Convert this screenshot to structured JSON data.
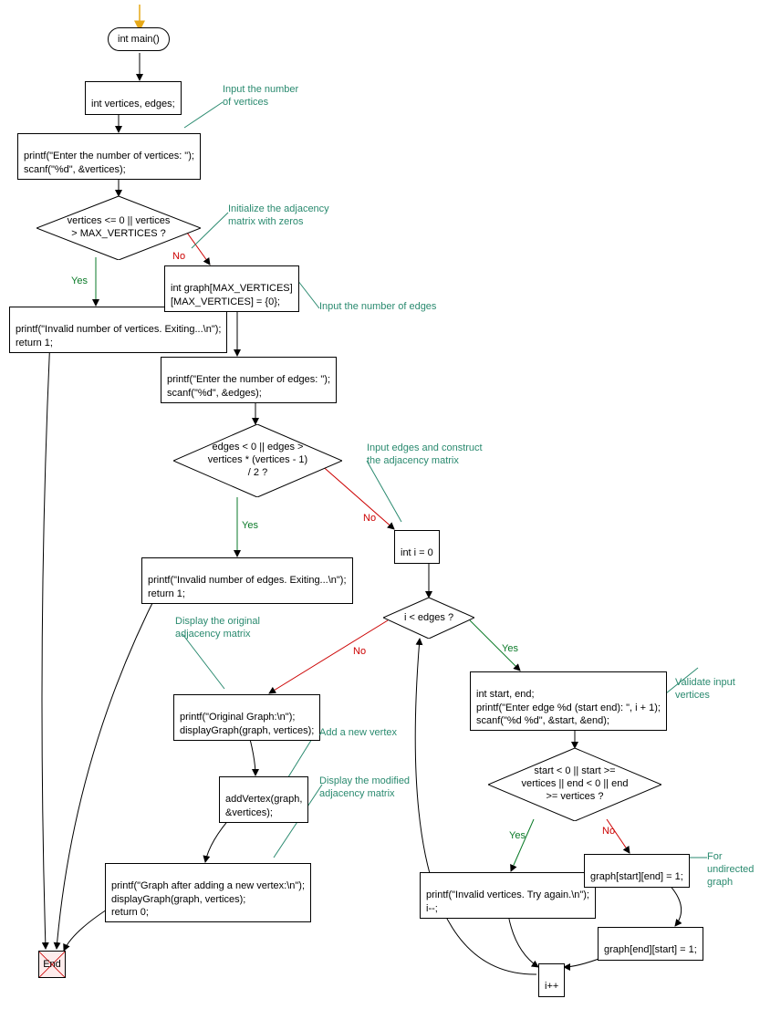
{
  "chart_data": {
    "type": "flowchart",
    "title": "",
    "nodes": {
      "start": {
        "label": "int main()",
        "shape": "terminal"
      },
      "n1": {
        "label": "int vertices, edges;",
        "shape": "process"
      },
      "n2": {
        "label": "printf(\"Enter the number of vertices: \");\nscanf(\"%d\", &vertices);",
        "shape": "process"
      },
      "d1": {
        "label": "vertices <= 0 || vertices\n> MAX_VERTICES ?",
        "shape": "decision"
      },
      "n3": {
        "label": "printf(\"Invalid number of vertices. Exiting...\\n\");\nreturn 1;",
        "shape": "process"
      },
      "n4": {
        "label": "int graph[MAX_VERTICES]\n[MAX_VERTICES] = {0};",
        "shape": "process"
      },
      "n5": {
        "label": "printf(\"Enter the number of edges: \");\nscanf(\"%d\", &edges);",
        "shape": "process"
      },
      "d2": {
        "label": "edges < 0 || edges >\nvertices * (vertices - 1)\n/ 2 ?",
        "shape": "decision"
      },
      "n6": {
        "label": "printf(\"Invalid number of edges. Exiting...\\n\");\nreturn 1;",
        "shape": "process"
      },
      "n7": {
        "label": "int i = 0",
        "shape": "process"
      },
      "d3": {
        "label": "i < edges ?",
        "shape": "decision"
      },
      "n8": {
        "label": "int start, end;\nprintf(\"Enter edge %d (start end): \", i + 1);\nscanf(\"%d %d\", &start, &end);",
        "shape": "process"
      },
      "d4": {
        "label": "start < 0 || start >=\nvertices || end < 0 || end\n>= vertices ?",
        "shape": "decision"
      },
      "n9": {
        "label": "printf(\"Invalid vertices. Try again.\\n\");\ni--;",
        "shape": "process"
      },
      "n10": {
        "label": "graph[start][end] = 1;",
        "shape": "process"
      },
      "n11": {
        "label": "graph[end][start] = 1;",
        "shape": "process"
      },
      "n12": {
        "label": "i++",
        "shape": "process"
      },
      "n13": {
        "label": "printf(\"Original Graph:\\n\");\ndisplayGraph(graph, vertices);",
        "shape": "process"
      },
      "n14": {
        "label": "addVertex(graph,\n&vertices);",
        "shape": "process"
      },
      "n15": {
        "label": "printf(\"Graph after adding a new vertex:\\n\");\ndisplayGraph(graph, vertices);\nreturn 0;",
        "shape": "process"
      },
      "end": {
        "label": "End",
        "shape": "end"
      }
    },
    "edges": [
      {
        "from": "start",
        "to": "n1"
      },
      {
        "from": "n1",
        "to": "n2"
      },
      {
        "from": "n2",
        "to": "d1"
      },
      {
        "from": "d1",
        "to": "n3",
        "label": "Yes"
      },
      {
        "from": "d1",
        "to": "n4",
        "label": "No"
      },
      {
        "from": "n4",
        "to": "n5"
      },
      {
        "from": "n5",
        "to": "d2"
      },
      {
        "from": "d2",
        "to": "n6",
        "label": "Yes"
      },
      {
        "from": "d2",
        "to": "n7",
        "label": "No"
      },
      {
        "from": "n7",
        "to": "d3"
      },
      {
        "from": "d3",
        "to": "n8",
        "label": "Yes"
      },
      {
        "from": "d3",
        "to": "n13",
        "label": "No"
      },
      {
        "from": "n8",
        "to": "d4"
      },
      {
        "from": "d4",
        "to": "n9",
        "label": "Yes"
      },
      {
        "from": "d4",
        "to": "n10",
        "label": "No"
      },
      {
        "from": "n10",
        "to": "n11"
      },
      {
        "from": "n9",
        "to": "n12"
      },
      {
        "from": "n11",
        "to": "n12"
      },
      {
        "from": "n12",
        "to": "d3"
      },
      {
        "from": "n13",
        "to": "n14"
      },
      {
        "from": "n14",
        "to": "n15"
      },
      {
        "from": "n3",
        "to": "end"
      },
      {
        "from": "n6",
        "to": "end"
      },
      {
        "from": "n15",
        "to": "end"
      }
    ],
    "annotations": {
      "a1": "Input the number\nof vertices",
      "a2": "Initialize the adjacency\nmatrix with zeros",
      "a3": "Input the number of edges",
      "a4": "Input edges and construct\nthe adjacency matrix",
      "a5": "Validate input vertices",
      "a6": "For undirected graph",
      "a7": "Display the original\nadjacency matrix",
      "a8": "Add a new vertex",
      "a9": "Display the modified\nadjacency matrix"
    },
    "edge_labels": {
      "yes": "Yes",
      "no": "No"
    }
  }
}
